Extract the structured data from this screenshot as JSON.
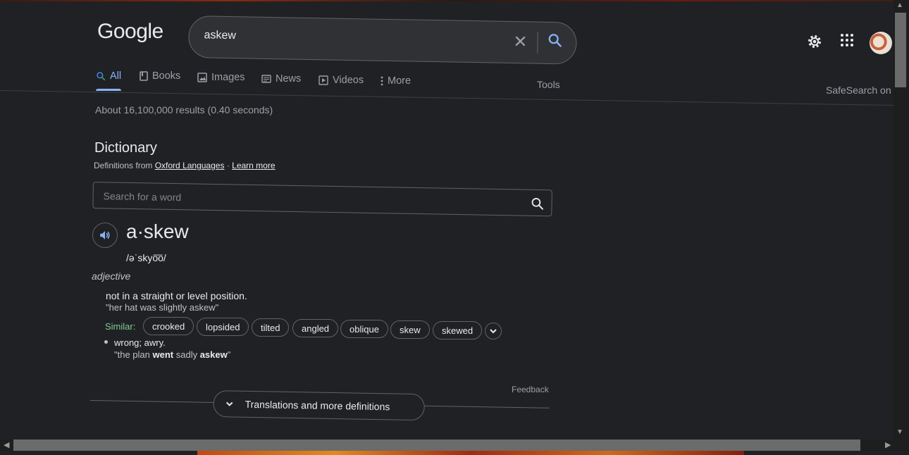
{
  "logo": "Google",
  "search": {
    "query": "askew"
  },
  "tabs": [
    {
      "label": "All",
      "icon": "search-icon",
      "active": true
    },
    {
      "label": "Books",
      "icon": "book-icon"
    },
    {
      "label": "Images",
      "icon": "image-icon"
    },
    {
      "label": "News",
      "icon": "news-icon"
    },
    {
      "label": "Videos",
      "icon": "video-icon"
    },
    {
      "label": "More",
      "icon": "more-vert-icon"
    }
  ],
  "tools": "Tools",
  "safesearch": "SafeSearch on",
  "stats": "About 16,100,000 results (0.40 seconds)",
  "dictionary": {
    "title": "Dictionary",
    "from_prefix": "Definitions from",
    "source": "Oxford Languages",
    "sep": "·",
    "learn_more": "Learn more",
    "search_placeholder": "Search for a word",
    "headword": "a·skew",
    "phonetic": "/əˈskyo͞o/",
    "pos": "adjective",
    "definition1": "not in a straight or level position.",
    "example1": "\"her hat was slightly askew\"",
    "similar_label": "Similar:",
    "similar": [
      "crooked",
      "lopsided",
      "tilted",
      "angled",
      "oblique",
      "skew",
      "skewed"
    ],
    "definition2": "wrong; awry.",
    "example2_parts": [
      "\"the plan ",
      "went",
      " sadly ",
      "askew",
      "\""
    ],
    "feedback": "Feedback",
    "more_definitions": "Translations and more definitions"
  },
  "colors": {
    "background": "#202124",
    "accent": "#8ab4f8",
    "similar": "#81c995"
  }
}
